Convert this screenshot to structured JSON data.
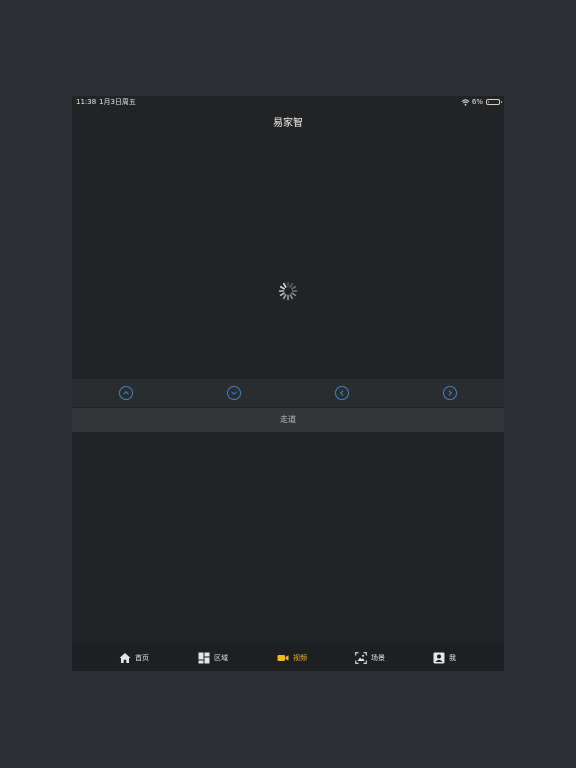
{
  "status_bar": {
    "time": "11:38",
    "date": "1月3日周五",
    "battery": "6%",
    "battery_level": 0.06
  },
  "header": {
    "title": "易家智"
  },
  "ptz": {
    "buttons": [
      "up-icon",
      "down-icon",
      "left-icon",
      "right-icon"
    ],
    "accent": "#3f84c5"
  },
  "camera": {
    "name": "走道"
  },
  "tabs": [
    {
      "label": "首页",
      "icon": "home-icon"
    },
    {
      "label": "区域",
      "icon": "area-icon"
    },
    {
      "label": "视频",
      "icon": "video-icon",
      "active": true
    },
    {
      "label": "场景",
      "icon": "scene-icon"
    },
    {
      "label": "我",
      "icon": "profile-icon"
    }
  ],
  "colors": {
    "active": "#f5b81c",
    "background": "#222325"
  }
}
